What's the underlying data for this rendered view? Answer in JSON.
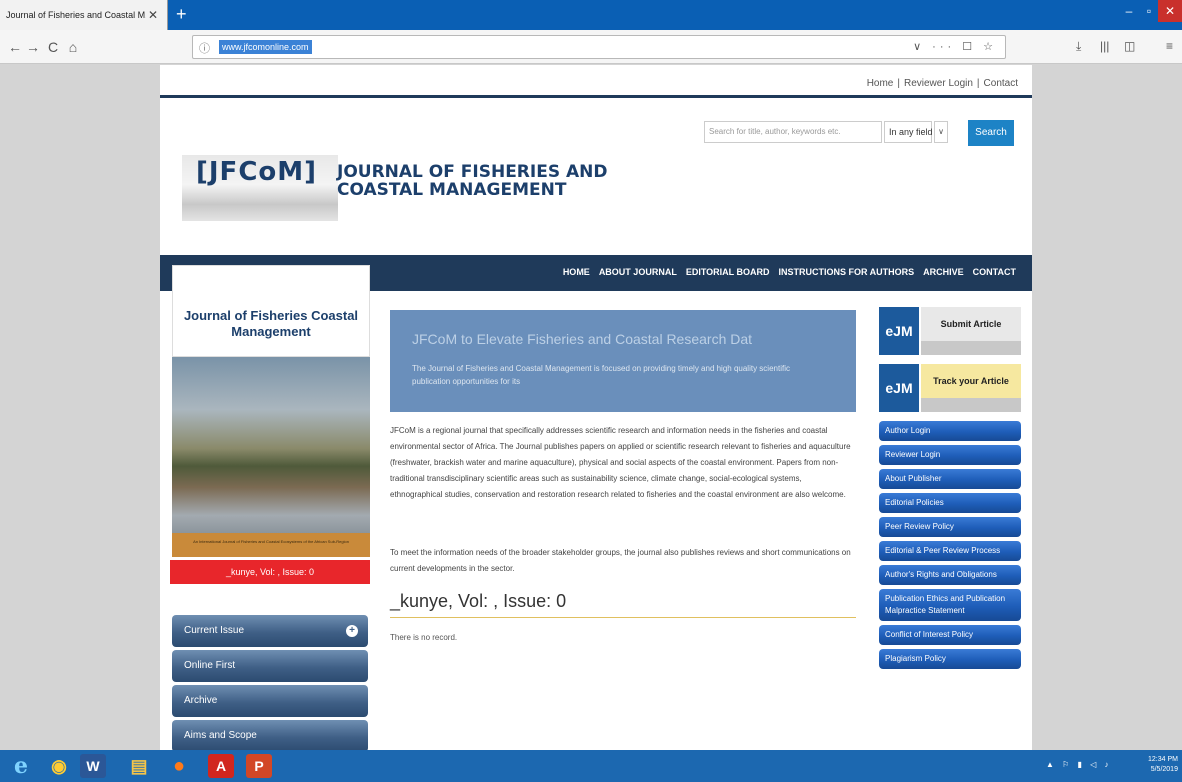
{
  "browser": {
    "tab_title": "Journal of Fisheries and Coastal M...",
    "tab_close": "✕",
    "new_tab": "+",
    "back": "←",
    "forward": "→",
    "reload": "C",
    "home": "⌂",
    "url_info_icon": "ⓘ",
    "url": "www.jfcomonline.com",
    "url_actions": "∨ ··· ☐ ☆",
    "download": "⤓",
    "library": "|||",
    "sidebar": "◫",
    "menu": "≡",
    "minimize": "–",
    "maximize": "▫",
    "close": "✕"
  },
  "site": {
    "toplinks": [
      "Home",
      "Reviewer Login",
      "Contact"
    ],
    "toplink_sep": "|",
    "search_placeholder": "Search for title, author, keywords etc.",
    "search_field": "In any field",
    "select_arrow": "∨",
    "search_button": "Search",
    "logo_mark": "[JFCoM]",
    "logo_title": "JOURNAL OF FISHERIES AND COASTAL MANAGEMENT",
    "nav": [
      "HOME",
      "ABOUT JOURNAL",
      "EDITORIAL BOARD",
      "INSTRUCTIONS FOR AUTHORS",
      "ARCHIVE",
      "CONTACT"
    ]
  },
  "left": {
    "journal_title": "Journal of Fisheries Coastal Management",
    "cover_caption": "An International Journal of Fisheries and Coastal Ecosystems of the African Sub-Region",
    "issue_badge": "_kunye, Vol: , Issue: 0",
    "menu": [
      "Current Issue",
      "Online First",
      "Archive",
      "Aims and Scope"
    ],
    "plus": "+"
  },
  "center": {
    "banner_title": "JFCoM to Elevate Fisheries and Coastal Research Dat",
    "banner_text": "The Journal of Fisheries and Coastal Management is focused on providing timely and high quality scientific publication opportunities for its",
    "intro": "JFCoM is a regional journal that specifically addresses scientific research and information needs in the fisheries and coastal environmental sector of Africa. The Journal publishes papers on applied or scientific research relevant to fisheries and aquaculture (freshwater, brackish water and marine aquaculture), physical and social aspects of the coastal environment. Papers from non-traditional transdisciplinary scientific areas such as sustainability science, climate change, social-ecological systems, ethnographical studies, conservation and restoration research related to fisheries and the coastal environment are also welcome.",
    "intro2": "To meet the information needs of the broader stakeholder groups, the journal also publishes reviews and short communications on current developments in the sector.",
    "issue_heading": "_kunye, Vol: , Issue: 0",
    "no_record": "There is no record."
  },
  "right": {
    "ejm_logo": "eJM",
    "submit": "Submit Article",
    "track": "Track your Article",
    "menu": [
      "Author Login",
      "Reviewer Login",
      "About Publisher",
      "Editorial Policies",
      "Peer Review Policy",
      "Editorial & Peer Review Process",
      "Author's Rights and Obligations",
      "Publication Ethics and Publication Malpractice Statement",
      "Conflict of Interest Policy",
      "Plagiarism Policy"
    ]
  },
  "taskbar": {
    "ie": "e",
    "chrome": "◉",
    "word": "W",
    "explorer": "▤",
    "firefox": "●",
    "acrobat": "A",
    "powerpoint": "P",
    "tray": "▲ ⚐ ▮ ◁ ♪",
    "time": "12:34 PM",
    "date": "5/5/2019"
  },
  "colors": {
    "browser_blue": "#0a5fb4",
    "nav_navy": "#1f3a5a",
    "banner_blue": "#6a8fbb",
    "badge_red": "#e8262b",
    "link_blue": "#1e5db8",
    "taskbar_blue": "#1c68b0"
  },
  "icons": {
    "back": "arrow-left-icon",
    "forward": "arrow-right-icon",
    "reload": "reload-icon",
    "home": "home-icon",
    "info": "info-icon",
    "bookmark": "star-icon",
    "pocket": "pocket-icon",
    "download": "download-icon",
    "library": "library-icon",
    "menu": "hamburger-icon",
    "plus": "plus-icon"
  }
}
